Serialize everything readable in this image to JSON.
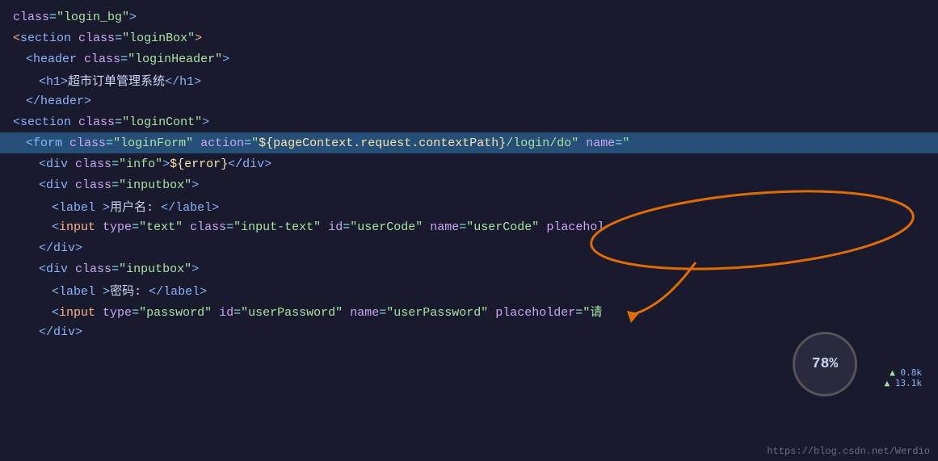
{
  "editor": {
    "lines": [
      {
        "id": "line1",
        "indent": 0,
        "highlighted": false,
        "content": "class=\"login_bg\">"
      },
      {
        "id": "line2",
        "indent": 0,
        "highlighted": false,
        "content_raw": "section_class_loginBox"
      },
      {
        "id": "line3",
        "indent": 1,
        "highlighted": false,
        "content_raw": "header_class_loginHeader"
      },
      {
        "id": "line4",
        "indent": 2,
        "highlighted": false,
        "content_raw": "h1_chinese"
      },
      {
        "id": "line5",
        "indent": 1,
        "highlighted": false,
        "content_raw": "close_header"
      },
      {
        "id": "line6",
        "indent": 0,
        "highlighted": false,
        "content_raw": "section_class_loginCont"
      },
      {
        "id": "line7",
        "indent": 1,
        "highlighted": true,
        "content_raw": "form_action"
      },
      {
        "id": "line8",
        "indent": 2,
        "highlighted": false,
        "content_raw": "div_info_error"
      },
      {
        "id": "line9",
        "indent": 2,
        "highlighted": false,
        "content_raw": "div_class_inputbox"
      },
      {
        "id": "line10",
        "indent": 3,
        "highlighted": false,
        "content_raw": "label_username"
      },
      {
        "id": "line11",
        "indent": 3,
        "highlighted": false,
        "content_raw": "input_userCode"
      },
      {
        "id": "line12",
        "indent": 2,
        "highlighted": false,
        "content_raw": "close_div"
      },
      {
        "id": "line13",
        "indent": 2,
        "highlighted": false,
        "content_raw": "div_class_inputbox2"
      },
      {
        "id": "line14",
        "indent": 3,
        "highlighted": false,
        "content_raw": "label_password"
      },
      {
        "id": "line15",
        "indent": 3,
        "highlighted": false,
        "content_raw": "input_userPassword"
      },
      {
        "id": "line16",
        "indent": 2,
        "highlighted": false,
        "content_raw": "close_div2"
      }
    ]
  },
  "perf": {
    "percentage": "78%",
    "stat1": "0.8k",
    "stat2": "13.1k"
  },
  "url": "https://blog.csdn.net/Werdio"
}
